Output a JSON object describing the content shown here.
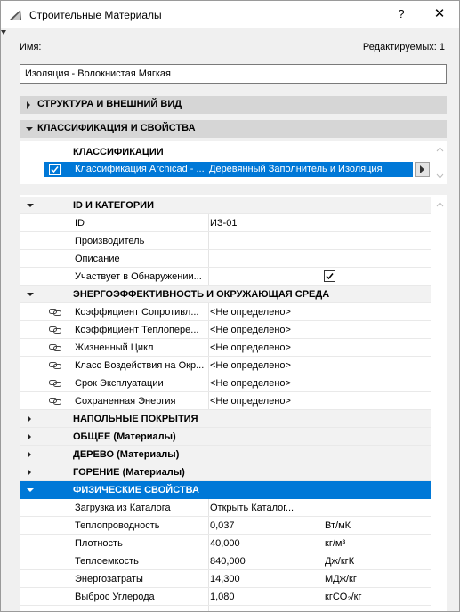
{
  "window": {
    "title": "Строительные Материалы",
    "help_label": "?",
    "close_label": "✕"
  },
  "header": {
    "name_label": "Имя:",
    "editable_label": "Редактируемых: 1",
    "name_value": "Изоляция - Волокнистая Мягкая"
  },
  "sections": [
    {
      "label": "СТРУКТУРА И ВНЕШНИЙ ВИД",
      "expanded": false
    },
    {
      "label": "КЛАССИФИКАЦИЯ И СВОЙСТВА",
      "expanded": true
    }
  ],
  "classifications": {
    "header": "КЛАССИФИКАЦИИ",
    "row": {
      "system": "Классификация Archicad - ...",
      "value": "Деревянный Заполнитель и Изоляция",
      "checked": true
    }
  },
  "properties": {
    "groups": [
      {
        "label": "ID И КАТЕГОРИИ",
        "expanded": true,
        "rows": [
          {
            "name": "ID",
            "value": "ИЗ-01"
          },
          {
            "name": "Производитель",
            "value": ""
          },
          {
            "name": "Описание",
            "value": ""
          },
          {
            "name": "Участвует в Обнаружении...",
            "value": "",
            "checkbox": true
          }
        ]
      },
      {
        "label": "ЭНЕРГОЭФФЕКТИВНОСТЬ И ОКРУЖАЮЩАЯ СРЕДА",
        "expanded": true,
        "rows": [
          {
            "name": "Коэффициент Сопротивл...",
            "value": "<Не определено>",
            "linked": true
          },
          {
            "name": "Коэффициент Теплопере...",
            "value": "<Не определено>",
            "linked": true
          },
          {
            "name": "Жизненный Цикл",
            "value": "<Не определено>",
            "linked": true
          },
          {
            "name": "Класс Воздействия на Окр...",
            "value": "<Не определено>",
            "linked": true
          },
          {
            "name": "Срок Эксплуатации",
            "value": "<Не определено>",
            "linked": true
          },
          {
            "name": "Сохраненная Энергия",
            "value": "<Не определено>",
            "linked": true
          }
        ]
      },
      {
        "label": "НАПОЛЬНЫЕ ПОКРЫТИЯ",
        "expanded": false
      },
      {
        "label": "ОБЩЕЕ (Материалы)",
        "expanded": false
      },
      {
        "label": "ДЕРЕВО (Материалы)",
        "expanded": false
      },
      {
        "label": "ГОРЕНИЕ (Материалы)",
        "expanded": false
      },
      {
        "label": "ФИЗИЧЕСКИЕ СВОЙСТВА",
        "expanded": true,
        "selected": true,
        "rows": [
          {
            "name": "Загрузка из Каталога",
            "value": "Открыть Каталог..."
          },
          {
            "name": "Теплопроводность",
            "value": "0,037",
            "unit": "Вт/мК"
          },
          {
            "name": "Плотность",
            "value": "40,000",
            "unit": "кг/м³"
          },
          {
            "name": "Теплоемкость",
            "value": "840,000",
            "unit": "Дж/кгК"
          },
          {
            "name": "Энергозатраты",
            "value": "14,300",
            "unit": "МДж/кг"
          },
          {
            "name": "Выброс Углерода",
            "value": "1,080",
            "unit": "кгCO₂/кг"
          }
        ]
      }
    ]
  },
  "colors": {
    "selection": "#0078d7",
    "section_bg": "#d6d6d6",
    "window_bg": "#f0f0f0"
  },
  "icons": {
    "app": "archicad-icon",
    "link": "link-icon",
    "expand": "triangle-icon"
  }
}
